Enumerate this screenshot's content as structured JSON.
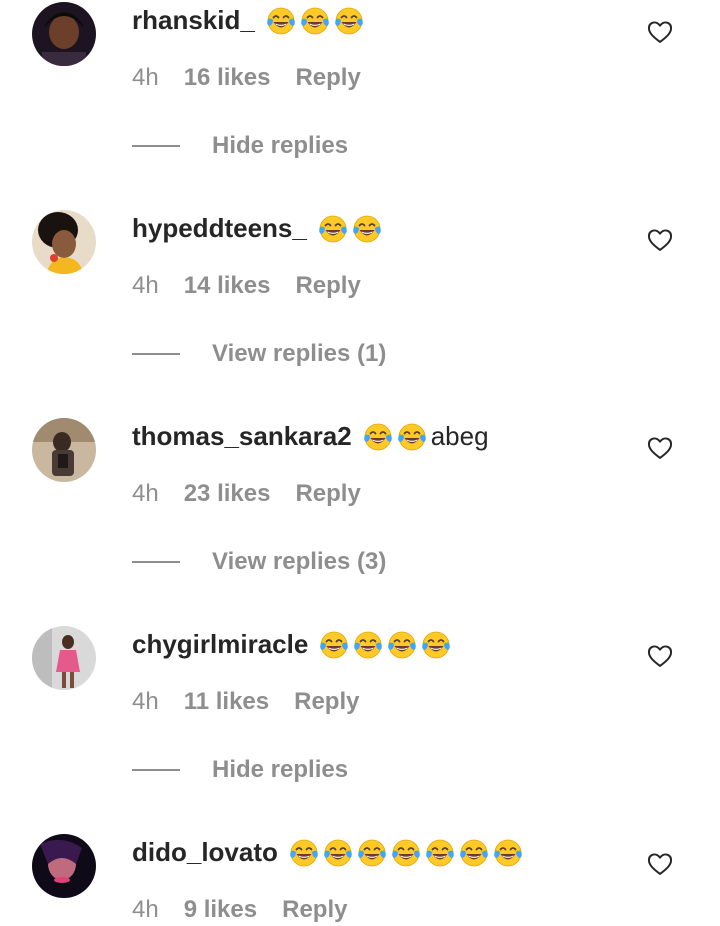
{
  "colors": {
    "text_primary": "#262626",
    "text_secondary": "#8e8e8e",
    "background": "#ffffff",
    "emoji_face": "#ffca28",
    "emoji_tears": "#42a5f5"
  },
  "emoji_name": "face-with-tears-of-joy",
  "comments": [
    {
      "username": "rhanskid_",
      "emoji_count": 3,
      "text_tail": "",
      "time": "4h",
      "likes": "16 likes",
      "reply": "Reply",
      "thread_label": "Hide replies",
      "like_icon": "heart-outline-icon"
    },
    {
      "username": "hypeddteens_",
      "emoji_count": 2,
      "text_tail": "",
      "time": "4h",
      "likes": "14 likes",
      "reply": "Reply",
      "thread_label": "View replies (1)",
      "like_icon": "heart-outline-icon"
    },
    {
      "username": "thomas_sankara2",
      "emoji_count": 2,
      "text_tail": "abeg",
      "time": "4h",
      "likes": "23 likes",
      "reply": "Reply",
      "thread_label": "View replies (3)",
      "like_icon": "heart-outline-icon"
    },
    {
      "username": "chygirlmiracle",
      "emoji_count": 4,
      "text_tail": "",
      "time": "4h",
      "likes": "11 likes",
      "reply": "Reply",
      "thread_label": "Hide replies",
      "like_icon": "heart-outline-icon"
    },
    {
      "username": "dido_lovato",
      "emoji_count": 7,
      "text_tail": "",
      "time": "4h",
      "likes": "9 likes",
      "reply": "Reply",
      "thread_label": "",
      "like_icon": "heart-outline-icon"
    }
  ]
}
